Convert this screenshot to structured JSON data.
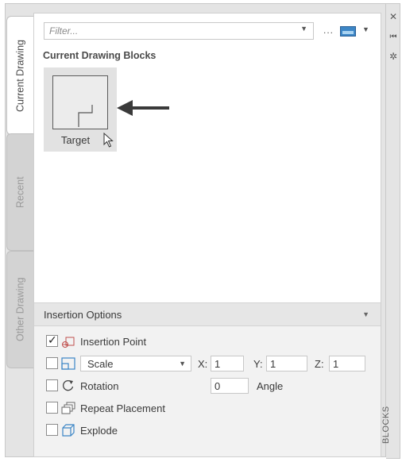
{
  "tabs": [
    {
      "label": "Current Drawing",
      "active": true
    },
    {
      "label": "Recent",
      "active": false
    },
    {
      "label": "Other Drawing",
      "active": false
    }
  ],
  "palette_title": "BLOCKS",
  "filter": {
    "placeholder": "Filter..."
  },
  "toolbar": {
    "more_label": "...",
    "view_icon": "thumbnail-view-icon"
  },
  "section_title": "Current Drawing Blocks",
  "blocks": [
    {
      "name": "Target"
    }
  ],
  "insertion_options": {
    "header": "Insertion Options",
    "insertion_point": {
      "label": "Insertion Point",
      "checked": true
    },
    "scale": {
      "label": "Scale",
      "checked": false,
      "x_label": "X:",
      "x_value": "1",
      "y_label": "Y:",
      "y_value": "1",
      "z_label": "Z:",
      "z_value": "1"
    },
    "rotation": {
      "label": "Rotation",
      "checked": false,
      "angle_value": "0",
      "angle_label": "Angle"
    },
    "repeat_placement": {
      "label": "Repeat Placement",
      "checked": false
    },
    "explode": {
      "label": "Explode",
      "checked": false
    }
  },
  "colors": {
    "accent": "#3c86c6",
    "panel_bg": "#ffffff",
    "frame_bg": "#e4e4e4"
  }
}
